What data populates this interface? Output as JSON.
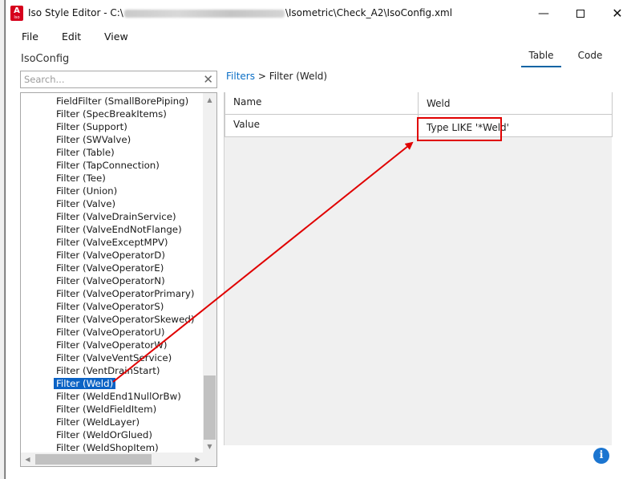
{
  "window": {
    "title_prefix": "Iso Style Editor - C:\\",
    "title_suffix": "\\Isometric\\Check_A2\\IsoConfig.xml",
    "app_icon_letter": "A",
    "app_icon_sub": "Iso"
  },
  "menu": {
    "file": "File",
    "edit": "Edit",
    "view": "View"
  },
  "section_title": "IsoConfig",
  "view_tabs": {
    "table": "Table",
    "code": "Code",
    "active": "Table"
  },
  "search": {
    "placeholder": "Search...",
    "value": ""
  },
  "tree": {
    "selected": "Filter (Weld)",
    "items": [
      "FieldFilter (SmallBorePiping)",
      "Filter (SpecBreakItems)",
      "Filter (Support)",
      "Filter (SWValve)",
      "Filter (Table)",
      "Filter (TapConnection)",
      "Filter (Tee)",
      "Filter (Union)",
      "Filter (Valve)",
      "Filter (ValveDrainService)",
      "Filter (ValveEndNotFlange)",
      "Filter (ValveExceptMPV)",
      "Filter (ValveOperatorD)",
      "Filter (ValveOperatorE)",
      "Filter (ValveOperatorN)",
      "Filter (ValveOperatorPrimary)",
      "Filter (ValveOperatorS)",
      "Filter (ValveOperatorSkewed)",
      "Filter (ValveOperatorU)",
      "Filter (ValveOperatorW)",
      "Filter (ValveVentService)",
      "Filter (VentDrainStart)",
      "Filter (Weld)",
      "Filter (WeldEnd1NullOrBw)",
      "Filter (WeldFieldItem)",
      "Filter (WeldLayer)",
      "Filter (WeldOrGlued)",
      "Filter (WeldShopItem)"
    ]
  },
  "breadcrumb": {
    "root": "Filters",
    "separator": ">",
    "current": "Filter (Weld)"
  },
  "properties": [
    {
      "name": "Name",
      "value": "Weld"
    },
    {
      "name": "Value",
      "value": "Type LIKE '*Weld'"
    }
  ],
  "colors": {
    "selection": "#0b63c5",
    "annotation": "#e00000",
    "link": "#0a6ec6",
    "info": "#1b75d0"
  },
  "icons": [
    "app-icon",
    "minimize-icon",
    "maximize-icon",
    "close-icon",
    "clear-search-icon",
    "scroll-arrow-icon",
    "info-icon"
  ]
}
